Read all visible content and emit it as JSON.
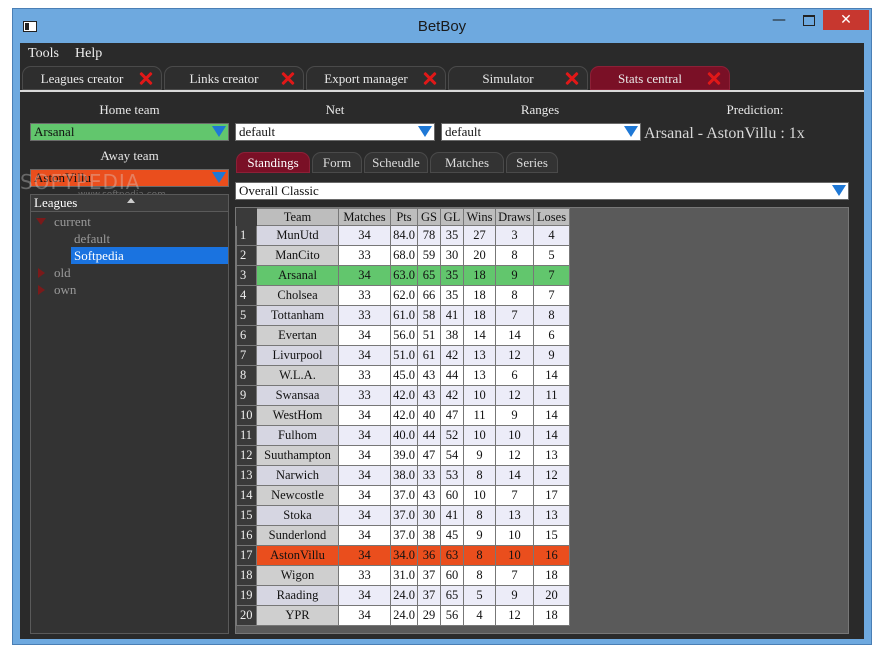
{
  "window": {
    "title": "BetBoy"
  },
  "menu": [
    "Tools",
    "Help"
  ],
  "tabs": [
    {
      "label": "Leagues creator"
    },
    {
      "label": "Links creator"
    },
    {
      "label": "Export manager"
    },
    {
      "label": "Simulator"
    },
    {
      "label": "Stats central",
      "active": true
    }
  ],
  "filters": {
    "home_label": "Home team",
    "home_value": "Arsanal",
    "away_label": "Away team",
    "away_value": "AstonVillu",
    "net_label": "Net",
    "net_value": "default",
    "ranges_label": "Ranges",
    "ranges_value": "default",
    "prediction_label": "Prediction:",
    "prediction_value": "Arsanal - AstonVillu : 1x"
  },
  "leagues": {
    "header": "Leagues",
    "tree": [
      {
        "label": "current",
        "expanded": true,
        "children": [
          "default",
          "Softpedia"
        ],
        "selected": "Softpedia"
      },
      {
        "label": "old",
        "expanded": false
      },
      {
        "label": "own",
        "expanded": false
      }
    ]
  },
  "subtabs": [
    {
      "label": "Standings",
      "active": true
    },
    {
      "label": "Form"
    },
    {
      "label": "Scheudle"
    },
    {
      "label": "Matches"
    },
    {
      "label": "Series"
    }
  ],
  "standings_filter": "Overall Classic",
  "watermark": {
    "main": "SOFTPEDIA",
    "sub": "www.softpedia.com"
  },
  "table": {
    "columns": [
      "Team",
      "Matches",
      "Pts",
      "GS",
      "GL",
      "Wins",
      "Draws",
      "Loses"
    ],
    "rows": [
      [
        1,
        "MunUtd",
        34,
        "84.0",
        78,
        35,
        27,
        3,
        4
      ],
      [
        2,
        "ManCito",
        33,
        "68.0",
        59,
        30,
        20,
        8,
        5
      ],
      [
        3,
        "Arsanal",
        34,
        "63.0",
        65,
        35,
        18,
        9,
        7
      ],
      [
        4,
        "Cholsea",
        33,
        "62.0",
        66,
        35,
        18,
        8,
        7
      ],
      [
        5,
        "Tottanham",
        33,
        "61.0",
        58,
        41,
        18,
        7,
        8
      ],
      [
        6,
        "Evertan",
        34,
        "56.0",
        51,
        38,
        14,
        14,
        6
      ],
      [
        7,
        "Livurpool",
        34,
        "51.0",
        61,
        42,
        13,
        12,
        9
      ],
      [
        8,
        "W.L.A.",
        33,
        "45.0",
        43,
        44,
        13,
        6,
        14
      ],
      [
        9,
        "Swansaa",
        33,
        "42.0",
        43,
        42,
        10,
        12,
        11
      ],
      [
        10,
        "WestHom",
        34,
        "42.0",
        40,
        47,
        11,
        9,
        14
      ],
      [
        11,
        "Fulhom",
        34,
        "40.0",
        44,
        52,
        10,
        10,
        14
      ],
      [
        12,
        "Suuthampton",
        34,
        "39.0",
        47,
        54,
        9,
        12,
        13
      ],
      [
        13,
        "Narwich",
        34,
        "38.0",
        33,
        53,
        8,
        14,
        12
      ],
      [
        14,
        "Newcostle",
        34,
        "37.0",
        43,
        60,
        10,
        7,
        17
      ],
      [
        15,
        "Stoka",
        34,
        "37.0",
        30,
        41,
        8,
        13,
        13
      ],
      [
        16,
        "Sunderlond",
        34,
        "37.0",
        38,
        45,
        9,
        10,
        15
      ],
      [
        17,
        "AstonVillu",
        34,
        "34.0",
        36,
        63,
        8,
        10,
        16
      ],
      [
        18,
        "Wigon",
        33,
        "31.0",
        37,
        60,
        8,
        7,
        18
      ],
      [
        19,
        "Raading",
        34,
        "24.0",
        37,
        65,
        5,
        9,
        20
      ],
      [
        20,
        "YPR",
        34,
        "24.0",
        29,
        56,
        4,
        12,
        18
      ]
    ],
    "highlight": {
      "home_row": 3,
      "home_color": "#62c66d",
      "away_row": 17,
      "away_color": "#ea4e1d"
    }
  }
}
